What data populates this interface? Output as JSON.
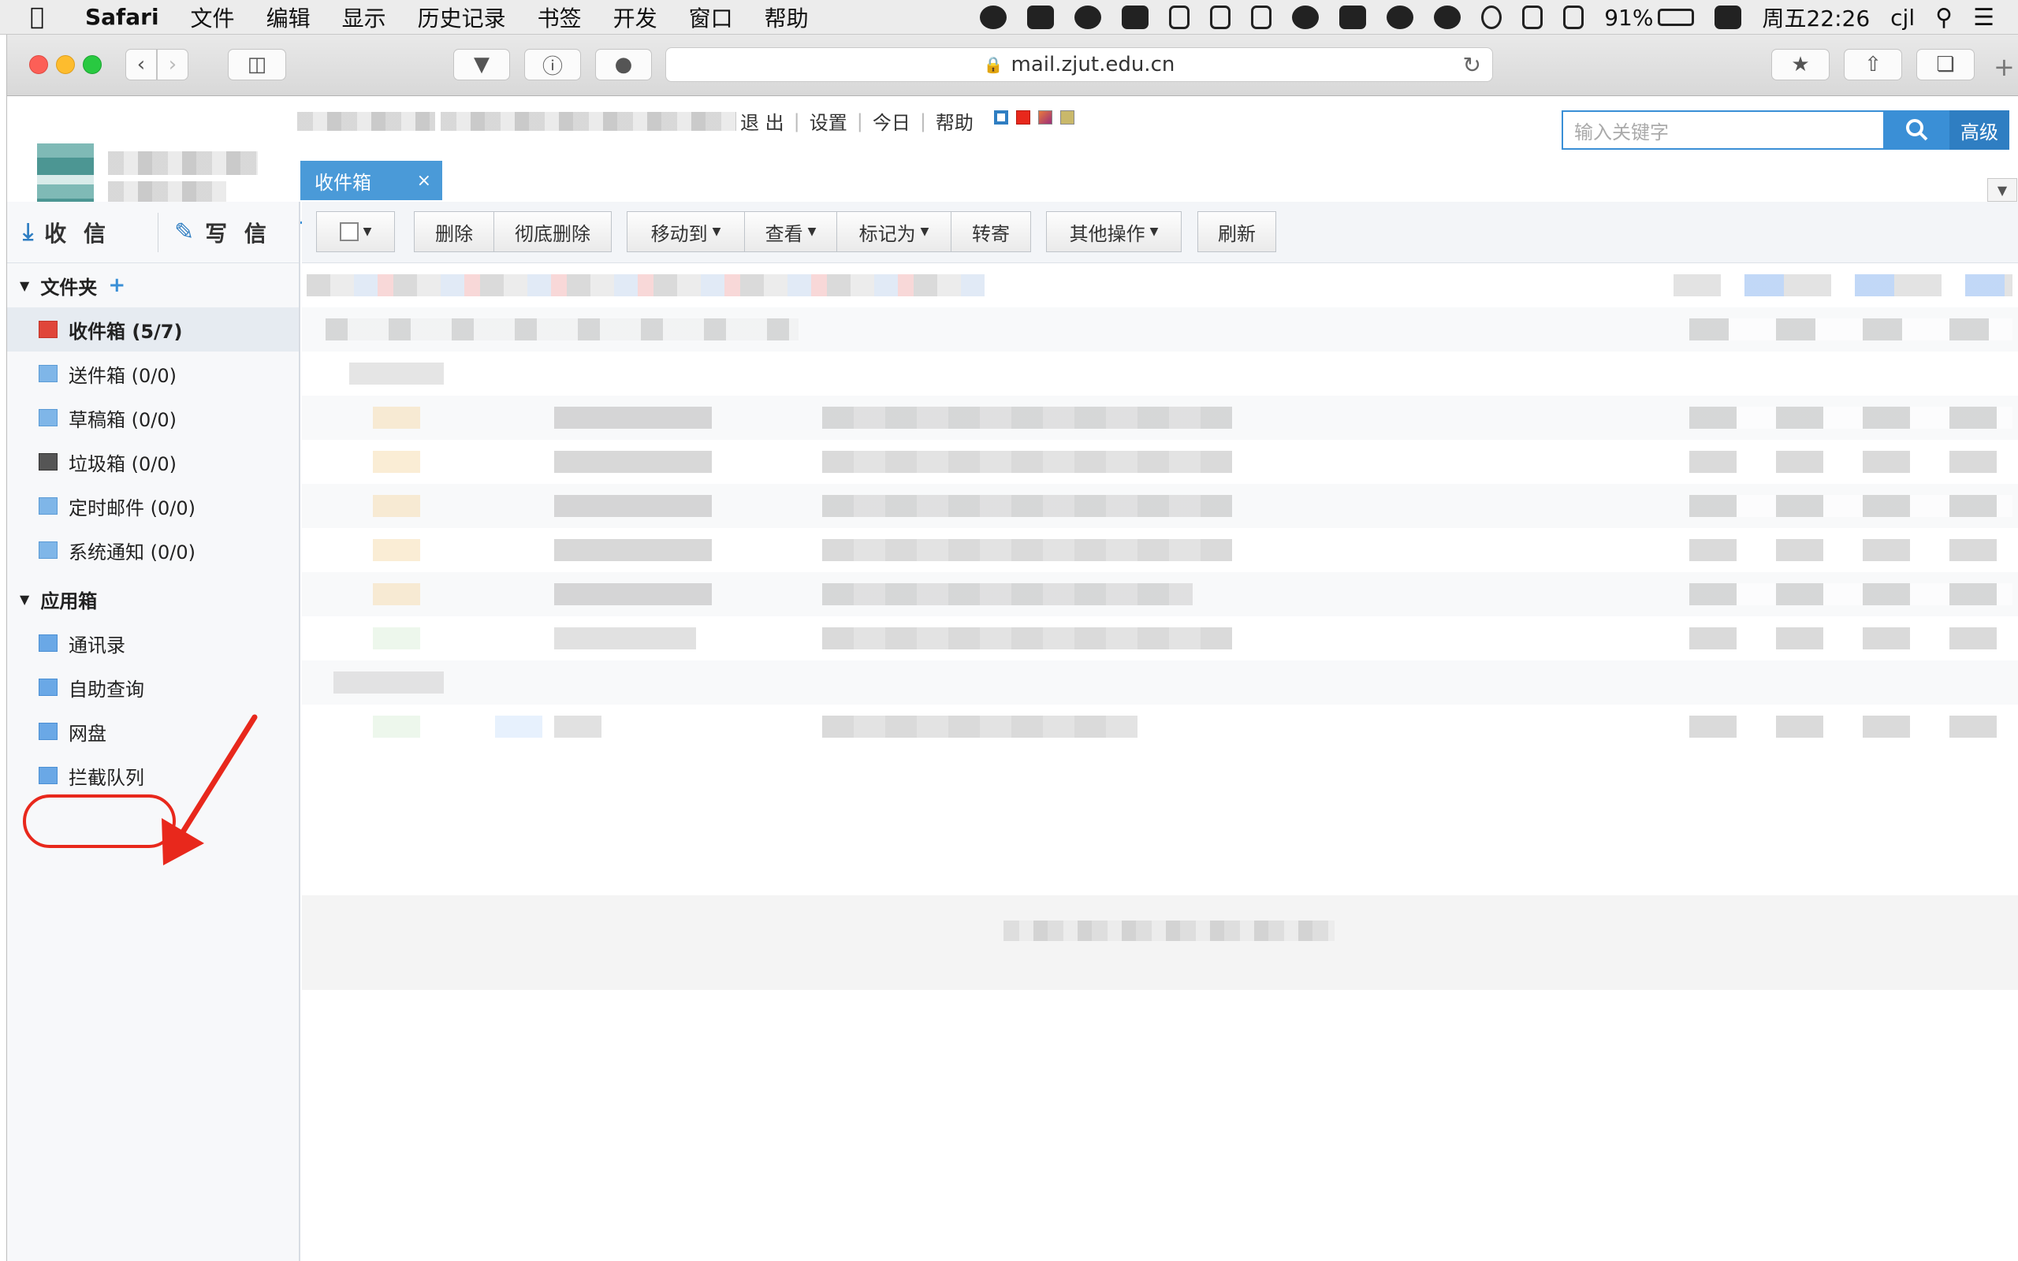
{
  "menubar": {
    "app_name": "Safari",
    "items": [
      "文件",
      "编辑",
      "显示",
      "历史记录",
      "书签",
      "开发",
      "窗口",
      "帮助"
    ],
    "battery": "91%",
    "clock": "周五22:26",
    "user": "cjl"
  },
  "browser": {
    "url": "mail.zjut.edu.cn"
  },
  "header": {
    "links": [
      "退 出",
      "设置",
      "今日",
      "帮助"
    ],
    "search_placeholder": "输入关键字",
    "advanced_label": "高级"
  },
  "tab": {
    "label": "收件箱",
    "close": "×"
  },
  "sidebar": {
    "receive_label": "收 信",
    "write_label": "写 信",
    "folders_heading": "文件夹",
    "folders": [
      {
        "label": "收件箱 (5/7)",
        "icon": "inbox-icon"
      },
      {
        "label": "送件箱 (0/0)",
        "icon": "folder-icon"
      },
      {
        "label": "草稿箱 (0/0)",
        "icon": "folder-icon"
      },
      {
        "label": "垃圾箱 (0/0)",
        "icon": "trash-icon"
      },
      {
        "label": "定时邮件 (0/0)",
        "icon": "folder-icon"
      },
      {
        "label": "系统通知 (0/0)",
        "icon": "folder-icon"
      }
    ],
    "apps_heading": "应用箱",
    "apps": [
      "通讯录",
      "自助查询",
      "网盘",
      "拦截队列"
    ]
  },
  "actions": {
    "delete": "删除",
    "purge": "彻底删除",
    "move_to": "移动到",
    "view": "查看",
    "mark_as": "标记为",
    "forward": "转寄",
    "other": "其他操作",
    "refresh": "刷新"
  },
  "colors": {
    "accent": "#3a8fd6",
    "annotation": "#e8281c"
  }
}
